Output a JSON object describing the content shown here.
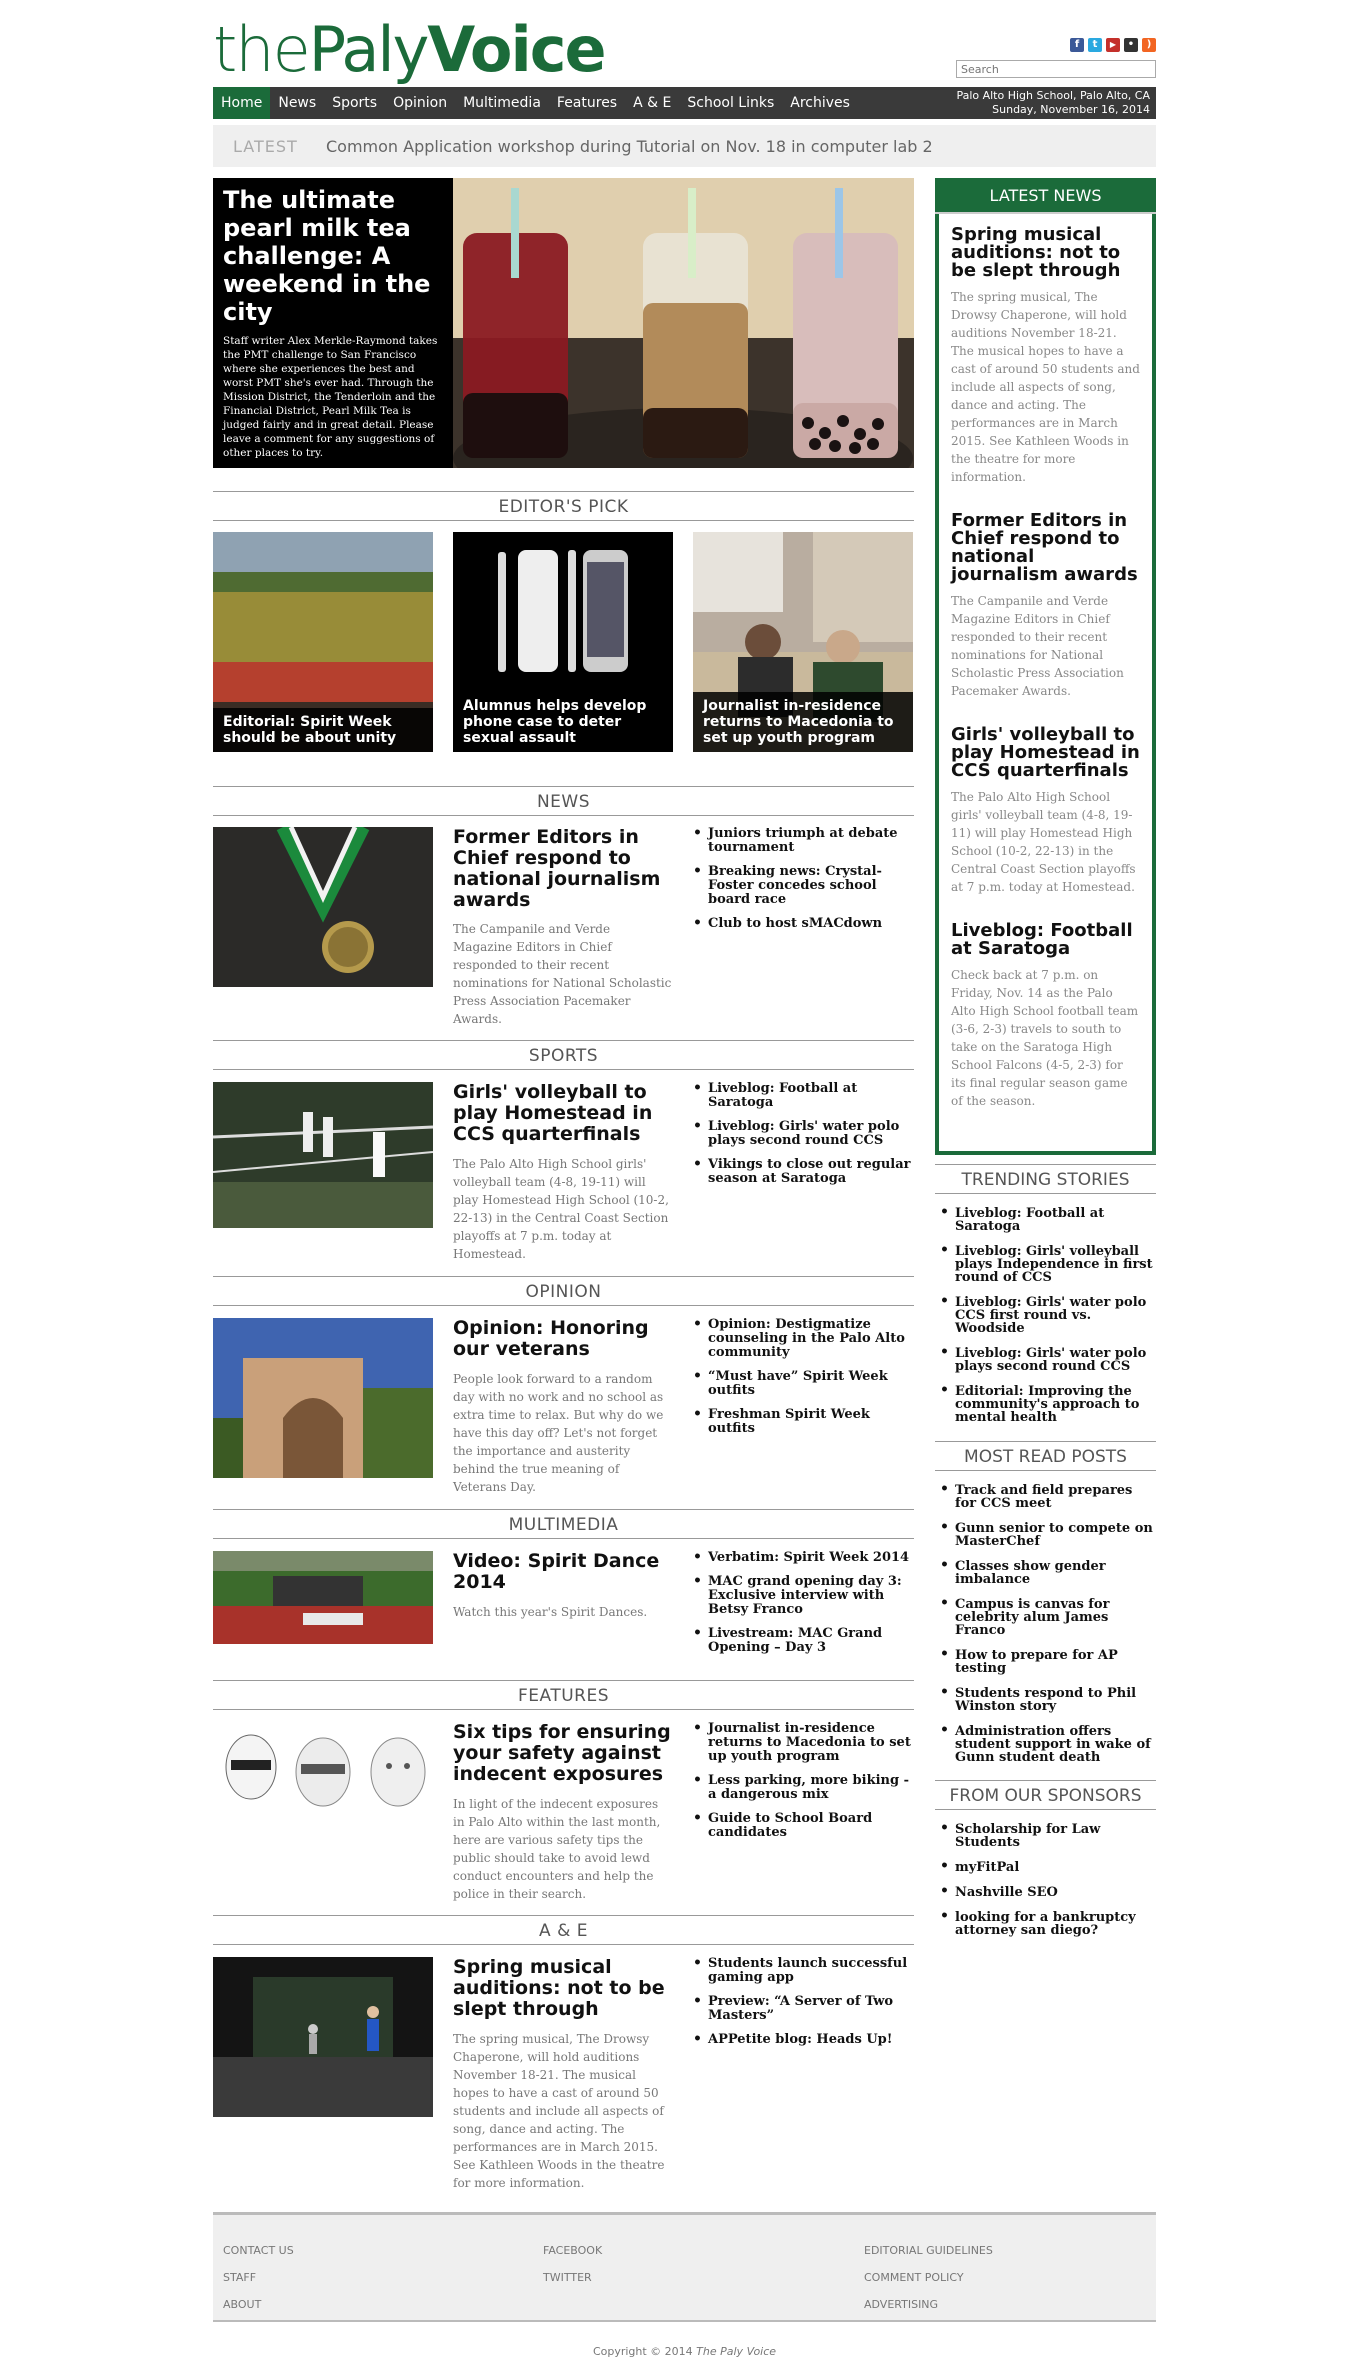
{
  "logo": {
    "part1": "the",
    "part2": "Paly",
    "part3": "Voice"
  },
  "social": {
    "facebook": "f",
    "twitter": "t",
    "youtube": "▶",
    "flickr": "•",
    "rss": ")"
  },
  "search": {
    "placeholder": "Search"
  },
  "nav": {
    "items": [
      "Home",
      "News",
      "Sports",
      "Opinion",
      "Multimedia",
      "Features",
      "A & E",
      "School Links",
      "Archives"
    ],
    "meta_line1": "Palo Alto High School, Palo Alto, CA",
    "meta_line2": "Sunday, November 16, 2014"
  },
  "ticker": {
    "label": "LATEST",
    "text": "Common Application workshop during Tutorial on Nov. 18 in computer lab 2"
  },
  "hero": {
    "title": "The ultimate pearl milk tea challenge: A weekend in the city",
    "excerpt": "Staff writer Alex Merkle-Raymond takes the PMT challenge to San Francisco where she experiences the best and worst PMT she's ever had. Through the Mission District, the Tenderloin and the Financial District, Pearl Milk Tea is judged fairly and in great detail. Please leave a comment for any suggestions of other places to try."
  },
  "editors_pick": {
    "heading": "EDITOR'S PICK",
    "items": [
      {
        "caption": "Editorial: Spirit Week should be about unity"
      },
      {
        "caption": "Alumnus helps develop phone case to deter sexual assault"
      },
      {
        "caption": "Journalist in-residence returns to Macedonia to set up youth program"
      }
    ]
  },
  "sections": {
    "news": {
      "heading": "NEWS",
      "title": "Former Editors in Chief respond to national journalism awards",
      "excerpt": "The Campanile and Verde Magazine Editors in Chief responded to their recent nominations for National Scholastic Press Association Pacemaker Awards.",
      "links": [
        "Juniors triumph at debate tournament",
        "Breaking news: Crystal-Foster concedes school board race",
        "Club to host sMACdown"
      ]
    },
    "sports": {
      "heading": "SPORTS",
      "title": "Girls' volleyball to play Homestead in CCS quarterfinals",
      "excerpt": "The Palo Alto High School girls' volleyball team (4-8, 19-11) will play Homestead High School (10-2, 22-13) in the Central Coast Section playoffs at 7 p.m. today at Homestead.",
      "links": [
        "Liveblog: Football at Saratoga",
        "Liveblog: Girls' water polo plays second round CCS",
        "Vikings to close out regular season at Saratoga"
      ]
    },
    "opinion": {
      "heading": "OPINION",
      "title": "Opinion: Honoring our veterans",
      "excerpt": "People look forward to a random day with no work and no school as extra time to relax. But why do we have this day off? Let's not forget the importance and austerity behind the true meaning of Veterans Day.",
      "links": [
        "Opinion: Destigmatize counseling in the Palo Alto community",
        "“Must have” Spirit Week outfits",
        "Freshman Spirit Week outfits"
      ]
    },
    "multimedia": {
      "heading": "MULTIMEDIA",
      "title": "Video: Spirit Dance 2014",
      "excerpt": "Watch this year's Spirit Dances.",
      "links": [
        "Verbatim: Spirit Week 2014",
        "MAC grand opening day 3: Exclusive interview with Betsy Franco",
        "Livestream: MAC Grand Opening – Day 3"
      ]
    },
    "features": {
      "heading": "FEATURES",
      "title": "Six tips for ensuring your safety against indecent exposures",
      "excerpt": "In light of the indecent exposures in Palo Alto within the last month, here are various safety tips the public should take to avoid lewd conduct encounters and help the police in their search.",
      "links": [
        "Journalist in-residence returns to Macedonia to set up youth program",
        "Less parking, more biking - a dangerous mix",
        "Guide to School Board candidates"
      ]
    },
    "ae": {
      "heading": "A & E",
      "title": "Spring musical auditions: not to be slept through",
      "excerpt": "The spring musical, The Drowsy Chaperone, will hold auditions November 18-21. The musical hopes to have a cast of around 50 students and include all aspects of song, dance and acting. The performances are in March 2015. See Kathleen Woods in the theatre for more information.",
      "links": [
        "Students launch successful gaming app",
        "Preview: “A Server of Two Masters”",
        "APPetite blog: Heads Up!"
      ]
    }
  },
  "latest_news": {
    "heading": "LATEST NEWS",
    "items": [
      {
        "title": "Spring musical auditions: not to be slept through",
        "excerpt": "The spring musical, The Drowsy Chaperone, will hold auditions November 18-21. The musical hopes to have a cast of around 50 students and include all aspects of song, dance and acting. The performances are in March 2015. See Kathleen Woods in the theatre for more information."
      },
      {
        "title": "Former Editors in Chief respond to national journalism awards",
        "excerpt": "The Campanile and Verde Magazine Editors in Chief responded to their recent nominations for National Scholastic Press Association Pacemaker Awards."
      },
      {
        "title": "Girls' volleyball to play Homestead in CCS quarterfinals",
        "excerpt": "The Palo Alto High School girls' volleyball team (4-8, 19-11) will play Homestead High School (10-2, 22-13) in the Central Coast Section playoffs at 7 p.m. today at Homestead."
      },
      {
        "title": "Liveblog: Football at Saratoga",
        "excerpt": "Check back at 7 p.m. on Friday, Nov. 14 as the Palo Alto High School football team (3-6, 2-3) travels to south to take on the Saratoga High School Falcons (4-5, 2-3) for its final regular season game of the season."
      }
    ]
  },
  "trending": {
    "heading": "TRENDING STORIES",
    "items": [
      "Liveblog: Football at Saratoga",
      "Liveblog: Girls' volleyball plays Independence in first round of CCS",
      "Liveblog: Girls' water polo CCS first round vs. Woodside",
      "Liveblog: Girls' water polo plays second round CCS",
      "Editorial: Improving the community's approach to mental health"
    ]
  },
  "most_read": {
    "heading": "MOST READ POSTS",
    "items": [
      "Track and field prepares for CCS meet",
      "Gunn senior to compete on MasterChef",
      "Classes show gender imbalance",
      "Campus is canvas for celebrity alum James Franco",
      "How to prepare for AP testing",
      "Students respond to Phil Winston story",
      "Administration offers student support in wake of Gunn student death"
    ]
  },
  "sponsors": {
    "heading": "FROM OUR SPONSORS",
    "items": [
      "Scholarship for Law Students",
      "myFitPal",
      "Nashville SEO",
      "looking for a bankruptcy attorney san diego?"
    ]
  },
  "footer": {
    "col1": [
      "CONTACT US",
      "STAFF",
      "ABOUT"
    ],
    "col2": [
      "FACEBOOK",
      "TWITTER"
    ],
    "col3": [
      "EDITORIAL GUIDELINES",
      "COMMENT POLICY",
      "ADVERTISING"
    ],
    "copyright_prefix": "Copyright © 2014 ",
    "copyright_name": "The Paly Voice"
  },
  "colors": {
    "brand_green": "#1b6b3a",
    "nav_bg": "#3a3a3a"
  }
}
